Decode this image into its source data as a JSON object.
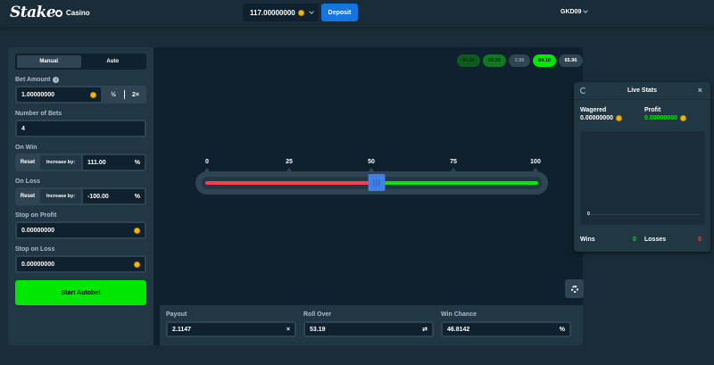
{
  "header": {
    "logo": "Stake",
    "casino_label": "Casino",
    "balance": "117.00000000",
    "deposit_label": "Deposit",
    "username": "GKD09"
  },
  "sidebar": {
    "tabs": [
      {
        "label": "Manual",
        "active": true
      },
      {
        "label": "Auto",
        "active": false
      }
    ],
    "bet_amount_label": "Bet Amount",
    "bet_amount_value": "1.00000000",
    "half_label": "½",
    "double_label": "2×",
    "number_of_bets_label": "Number of Bets",
    "number_of_bets_value": "4",
    "on_win_label": "On Win",
    "on_win_reset": "Reset",
    "on_win_increase": "Increase by:",
    "on_win_value": "111.00",
    "on_loss_label": "On Loss",
    "on_loss_reset": "Reset",
    "on_loss_increase": "Increase by:",
    "on_loss_value": "-100.00",
    "percent_symbol": "%",
    "stop_profit_label": "Stop on Profit",
    "stop_profit_value": "0.00000000",
    "stop_loss_label": "Stop on Loss",
    "stop_loss_value": "0.00000000",
    "start_label": "Start Autobet"
  },
  "history": [
    {
      "value": "94.25",
      "color": "#0c5a1e",
      "text_color": "#06300f"
    },
    {
      "value": "98.36",
      "color": "#0e7a22",
      "text_color": "#06300f"
    },
    {
      "value": "3.88",
      "color": "#2f4553",
      "text_color": "#8a96ae"
    },
    {
      "value": "84.10",
      "color": "#00e701",
      "text_color": "#05080a"
    },
    {
      "value": "65.96",
      "color": "#2f4553",
      "text_color": "#ffffff"
    }
  ],
  "slider": {
    "ticks": [
      "0",
      "25",
      "50",
      "75",
      "100"
    ],
    "min": 0,
    "max": 100,
    "roll_over": 53.19
  },
  "stats_bar": {
    "payout_label": "Payout",
    "payout_value": "2.1147",
    "payout_suffix": "×",
    "rollover_label": "Roll Over",
    "rollover_value": "53.19",
    "rollover_suffix": "⇄",
    "winchance_label": "Win Chance",
    "winchance_value": "46.8142",
    "winchance_suffix": "%"
  },
  "live_stats": {
    "title": "Live Stats",
    "close": "×",
    "wagered_label": "Wagered",
    "wagered_value": "0.00000000",
    "profit_label": "Profit",
    "profit_value": "0.00000000",
    "zero_label": "0",
    "wins_label": "Wins",
    "wins_value": "0",
    "losses_label": "Losses",
    "losses_value": "0",
    "profit_color": "#00e701",
    "loss_color": "#ff3d54"
  },
  "colors": {
    "accent_green": "#00e701",
    "accent_blue": "#1475e1",
    "red": "#ff3d54"
  }
}
